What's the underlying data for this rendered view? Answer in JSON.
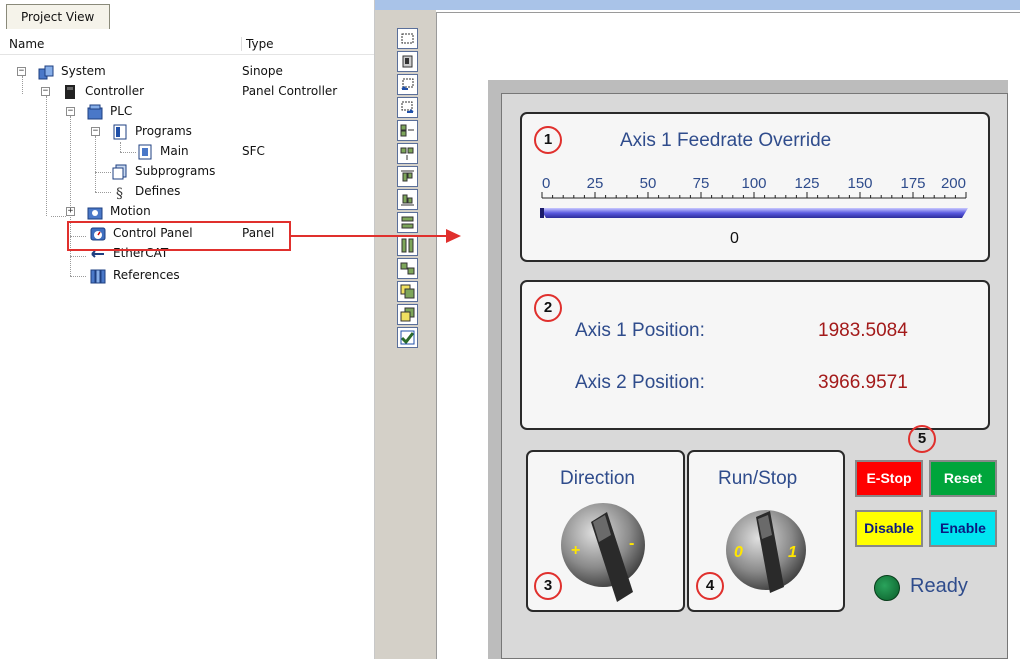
{
  "project_view": {
    "tab_label": "Project View",
    "col_name": "Name",
    "col_type": "Type",
    "tree": [
      {
        "label": "System",
        "type": "Sinope",
        "icon": "system-icon"
      },
      {
        "label": "Controller",
        "type": "Panel Controller",
        "icon": "controller-icon"
      },
      {
        "label": "PLC",
        "type": "",
        "icon": "plc-icon"
      },
      {
        "label": "Programs",
        "type": "",
        "icon": "programs-icon"
      },
      {
        "label": "Main",
        "type": "SFC",
        "icon": "program-file-icon"
      },
      {
        "label": "Subprograms",
        "type": "",
        "icon": "subprograms-icon"
      },
      {
        "label": "Defines",
        "type": "",
        "icon": "defines-icon"
      },
      {
        "label": "Motion",
        "type": "",
        "icon": "motion-icon"
      },
      {
        "label": "Control Panel",
        "type": "Panel",
        "icon": "control-panel-icon"
      },
      {
        "label": "EtherCAT",
        "type": "",
        "icon": "ethercat-icon"
      },
      {
        "label": "References",
        "type": "",
        "icon": "references-icon"
      }
    ]
  },
  "panel": {
    "feedrate": {
      "title": "Axis 1 Feedrate Override",
      "scale_labels": [
        "0",
        "25",
        "50",
        "75",
        "100",
        "125",
        "150",
        "175",
        "200"
      ],
      "value": "0",
      "scale_min": 0,
      "scale_max": 200,
      "level": 0
    },
    "positions": {
      "axis1_label": "Axis 1 Position:",
      "axis1_value": "1983.5084",
      "axis2_label": "Axis 2 Position:",
      "axis2_value": "3966.9571"
    },
    "direction": {
      "title": "Direction",
      "plus": "+",
      "minus": "-"
    },
    "runstop": {
      "title": "Run/Stop",
      "zero": "0",
      "one": "1"
    },
    "buttons": {
      "estop": "E-Stop",
      "reset": "Reset",
      "disable": "Disable",
      "enable": "Enable"
    },
    "status": {
      "label": "Ready",
      "led_color": "#0e7a35"
    }
  },
  "callouts": [
    "1",
    "2",
    "3",
    "4",
    "5"
  ],
  "colors": {
    "highlight_red": "#e0302d",
    "title_blue": "#2f4c8c",
    "value_red": "#a31a1a"
  }
}
